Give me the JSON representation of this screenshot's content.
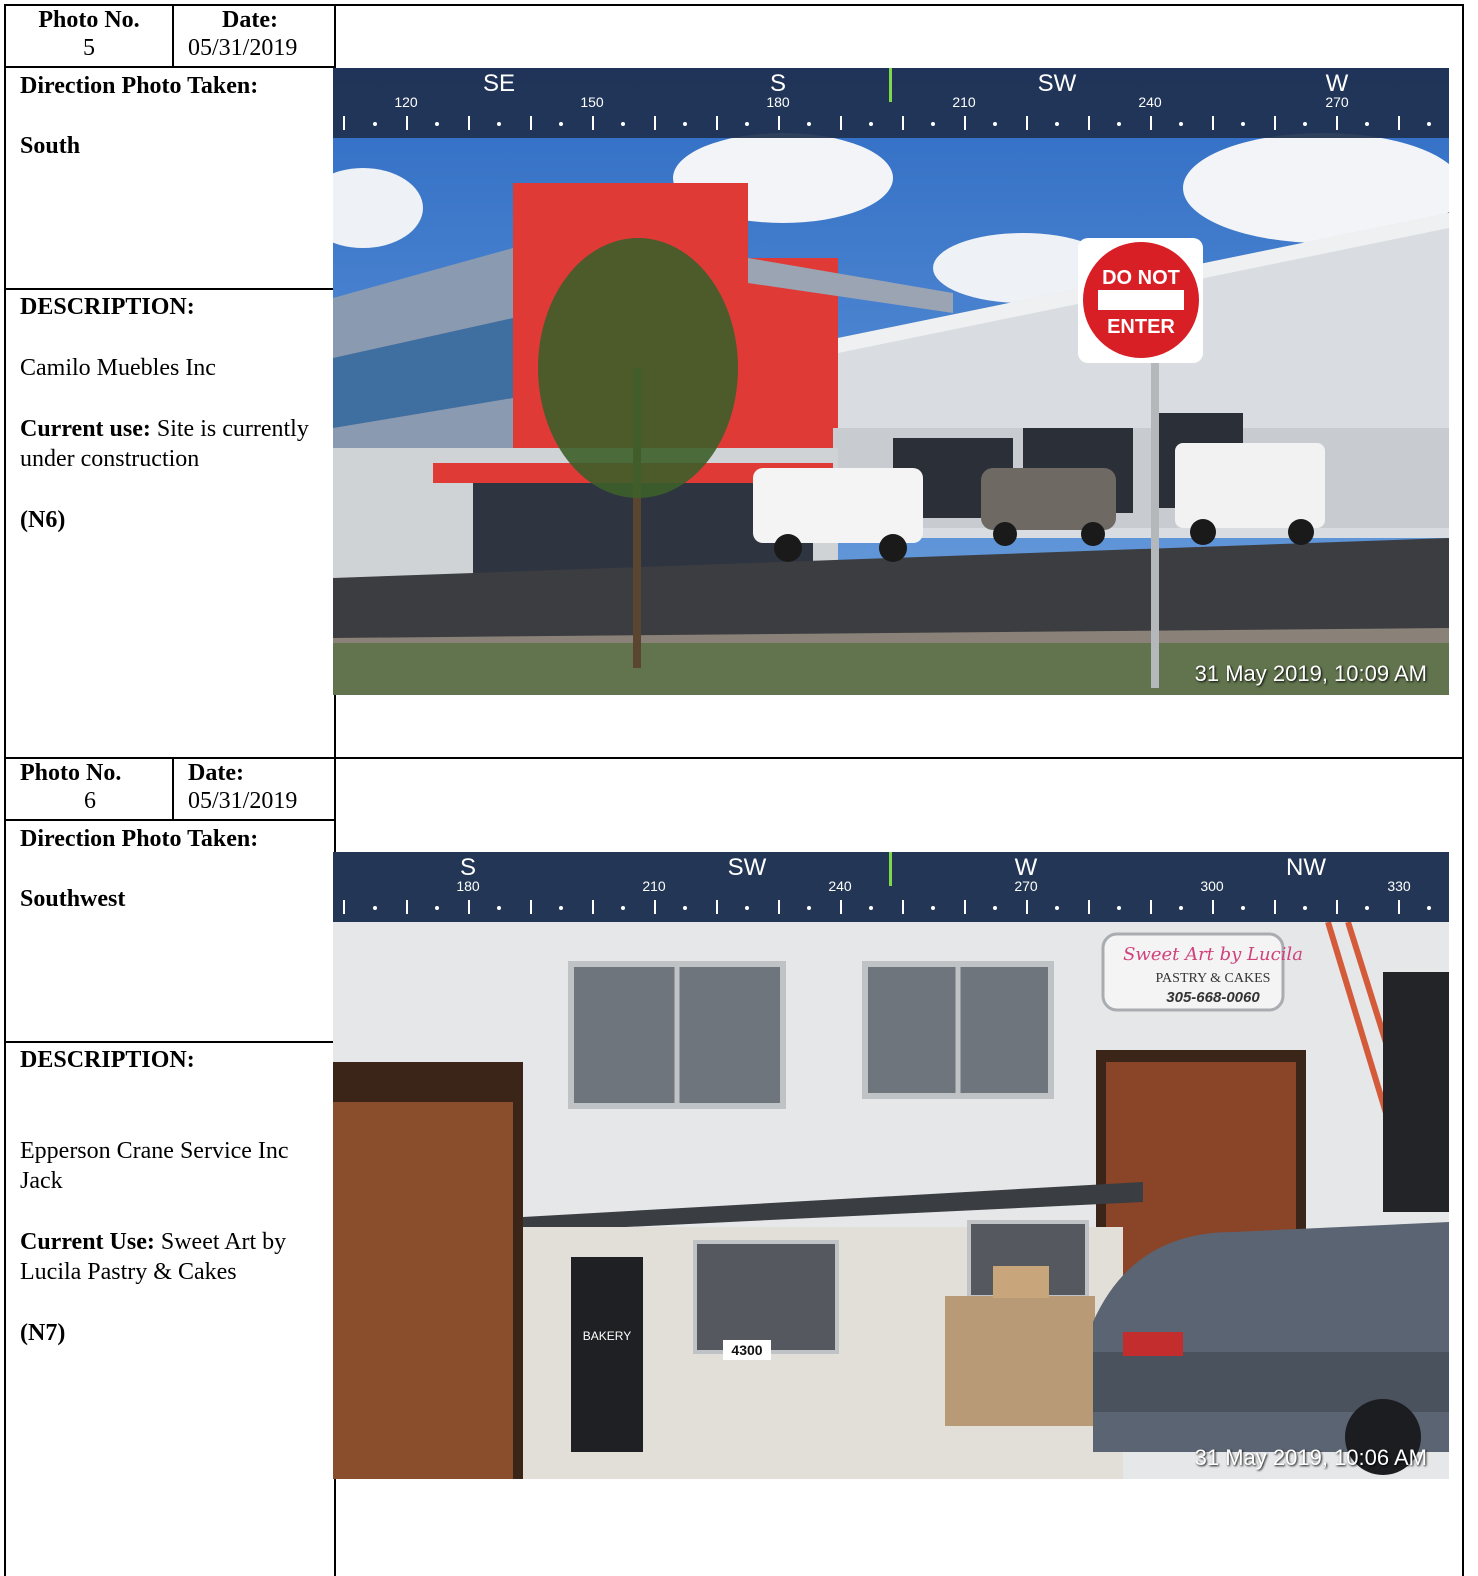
{
  "entries": [
    {
      "photo_no_label": "Photo No.",
      "photo_no": "5",
      "date_label": "Date:",
      "date": "05/31/2019",
      "direction_label": "Direction Photo Taken:",
      "direction": "South",
      "description_label": "DESCRIPTION:",
      "description": "Camilo Muebles Inc",
      "current_use_label": "Current use:",
      "current_use": "Site is currently under construction",
      "ref": "(N6)",
      "photo": {
        "timestamp": "31 May 2019, 10:09 AM",
        "compass_cardinals": [
          "SE",
          "S",
          "SW",
          "W"
        ],
        "compass_degrees": [
          "120",
          "150",
          "180",
          "210",
          "240",
          "270"
        ],
        "sign_line1": "DO NOT",
        "sign_line2": "ENTER"
      }
    },
    {
      "photo_no_label": "Photo No.",
      "photo_no": "6",
      "date_label": "Date:",
      "date": "05/31/2019",
      "direction_label": "Direction Photo Taken:",
      "direction": "Southwest",
      "description_label": "DESCRIPTION:",
      "description": "Epperson Crane Service Inc Jack",
      "current_use_label": "Current Use:",
      "current_use": "Sweet Art by Lucila Pastry & Cakes",
      "ref": "(N7)",
      "photo": {
        "timestamp": "31 May 2019, 10:06 AM",
        "compass_cardinals": [
          "S",
          "SW",
          "W",
          "NW"
        ],
        "compass_degrees": [
          "180",
          "210",
          "240",
          "270",
          "300",
          "330"
        ],
        "sign_title": "Sweet Art by Lucila",
        "sign_sub": "PASTRY & CAKES",
        "sign_phone": "305-668-0060",
        "address": "4300",
        "door_text": "BAKERY"
      }
    }
  ]
}
